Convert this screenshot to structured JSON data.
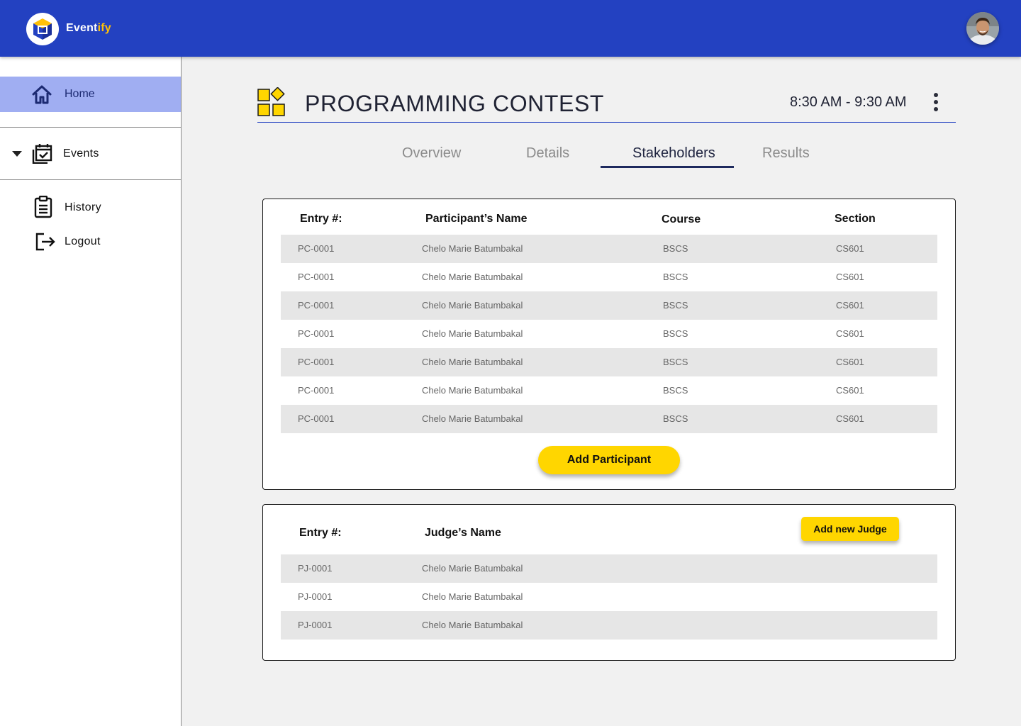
{
  "app": {
    "brand_main": "Event",
    "brand_accent": "ify",
    "colors": {
      "primary": "#2341c1",
      "accent": "#ffd600",
      "nav_active": "#a0aef2"
    }
  },
  "sidebar": {
    "items": [
      {
        "label": "Home",
        "icon": "home-icon",
        "active": true
      },
      {
        "label": "Events",
        "icon": "calendar-check-icon",
        "expanded": true
      },
      {
        "label": "History",
        "icon": "clipboard-icon"
      },
      {
        "label": "Logout",
        "icon": "logout-icon"
      }
    ]
  },
  "event": {
    "title": "PROGRAMMING CONTEST",
    "time": "8:30 AM - 9:30 AM"
  },
  "tabs": [
    {
      "label": "Overview"
    },
    {
      "label": "Details"
    },
    {
      "label": "Stakeholders",
      "active": true
    },
    {
      "label": "Results"
    }
  ],
  "participants": {
    "headers": [
      "Entry #:",
      "Participant’s Name",
      "Course",
      "Section"
    ],
    "rows": [
      [
        "PC-0001",
        "Chelo Marie Batumbakal",
        "BSCS",
        "CS601"
      ],
      [
        "PC-0001",
        "Chelo Marie Batumbakal",
        "BSCS",
        "CS601"
      ],
      [
        "PC-0001",
        "Chelo Marie Batumbakal",
        "BSCS",
        "CS601"
      ],
      [
        "PC-0001",
        "Chelo Marie Batumbakal",
        "BSCS",
        "CS601"
      ],
      [
        "PC-0001",
        "Chelo Marie Batumbakal",
        "BSCS",
        "CS601"
      ],
      [
        "PC-0001",
        "Chelo Marie Batumbakal",
        "BSCS",
        "CS601"
      ],
      [
        "PC-0001",
        "Chelo Marie Batumbakal",
        "BSCS",
        "CS601"
      ]
    ],
    "add_button": "Add Participant"
  },
  "judges": {
    "headers": [
      "Entry #:",
      "Judge’s Name"
    ],
    "rows": [
      [
        "PJ-0001",
        "Chelo Marie Batumbakal"
      ],
      [
        "PJ-0001",
        "Chelo Marie Batumbakal"
      ],
      [
        "PJ-0001",
        "Chelo Marie Batumbakal"
      ]
    ],
    "add_button": "Add new Judge"
  }
}
